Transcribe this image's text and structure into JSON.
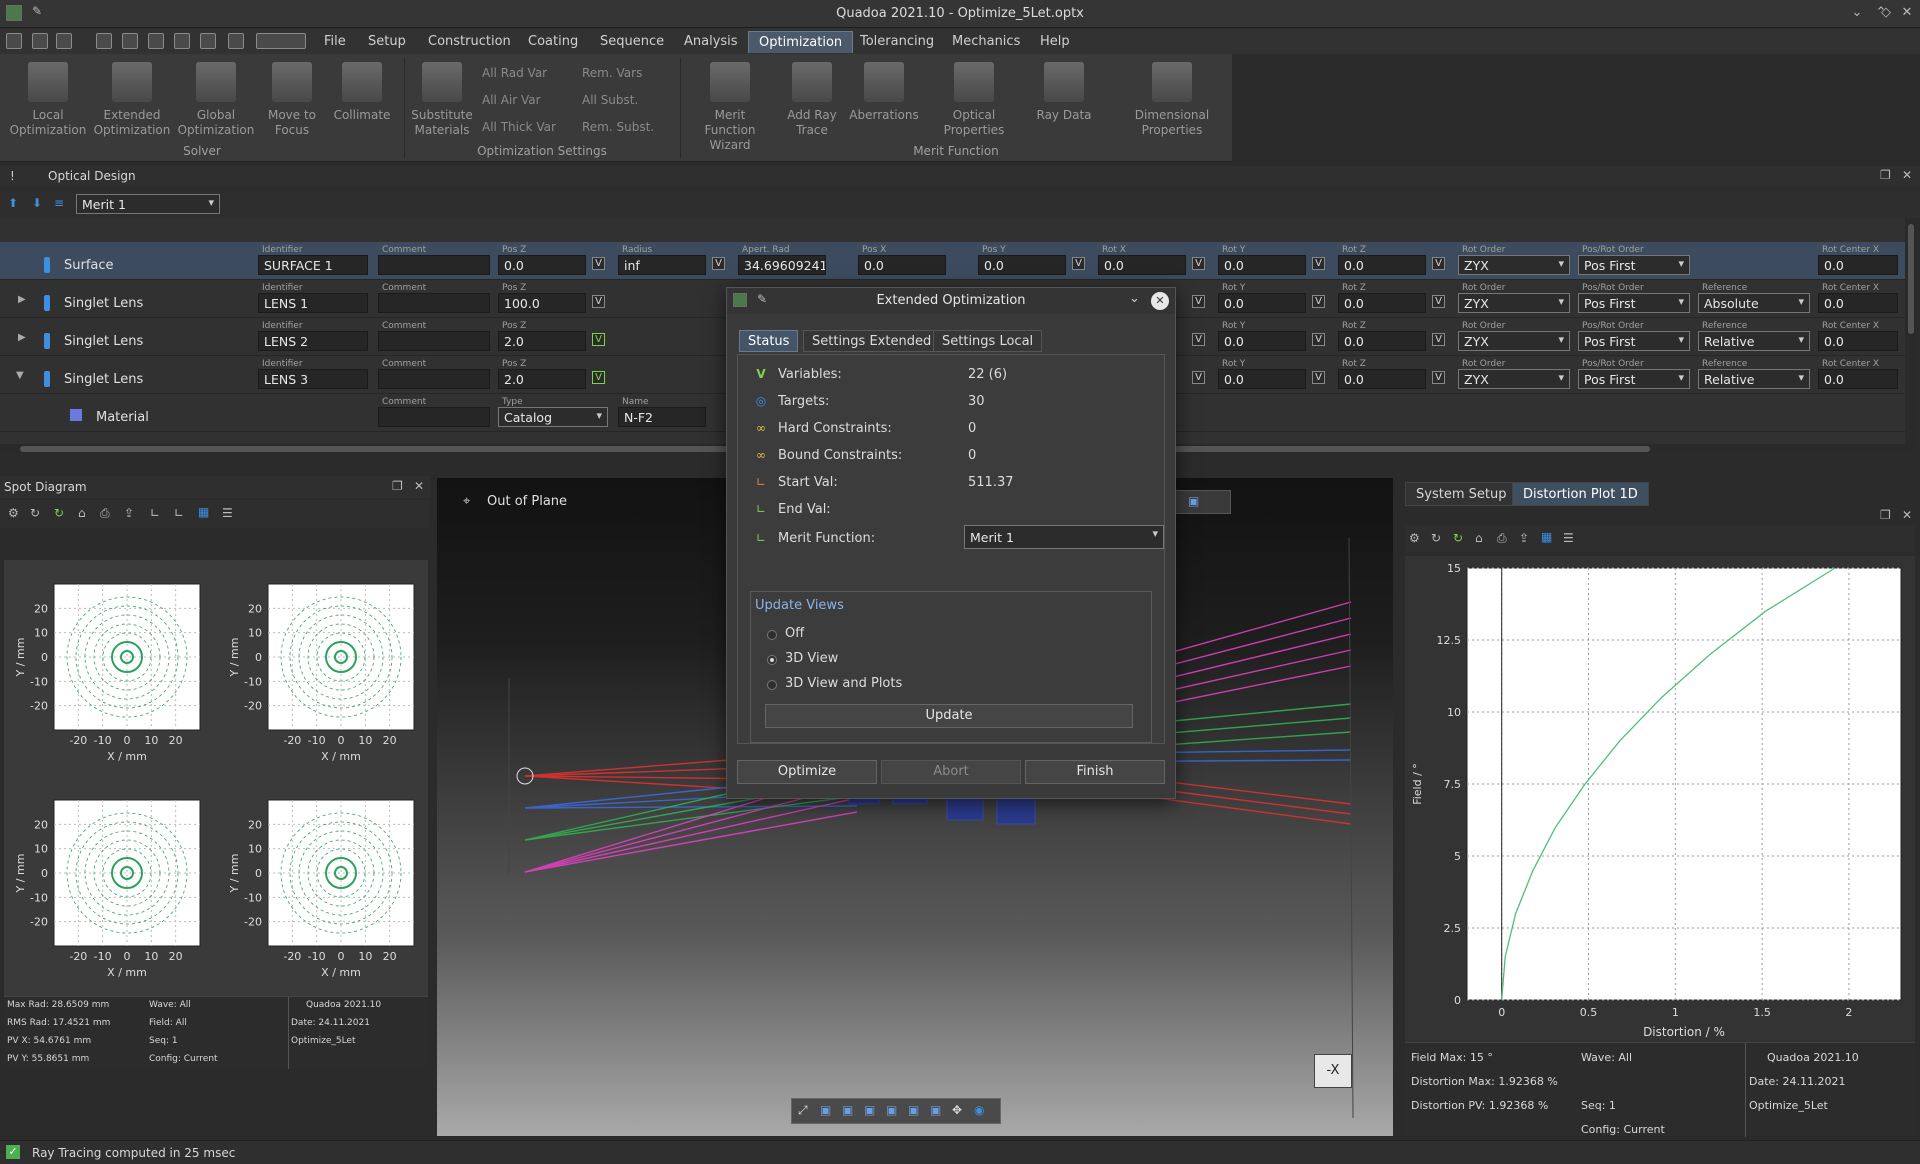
{
  "window": {
    "title": "Quadoa 2021.10 - Optimize_5Let.optx"
  },
  "menu": [
    "File",
    "Setup",
    "Construction",
    "Coating",
    "Sequence",
    "Analysis",
    "Optimization",
    "Tolerancing",
    "Mechanics",
    "Help"
  ],
  "ribbon": {
    "solver": {
      "group": "Solver",
      "buttons": [
        "Local Optimization",
        "Extended Optimization",
        "Global Optimization",
        "Move to Focus",
        "Collimate"
      ]
    },
    "settings": {
      "group": "Optimization Settings",
      "main": "Substitute Materials",
      "small": [
        "All Rad Var",
        "All Air Var",
        "All Thick Var",
        "Rem. Vars",
        "All Subst.",
        "Rem. Subst."
      ]
    },
    "merit": {
      "group": "Merit Function",
      "buttons": [
        "Merit Function Wizard",
        "Add Ray Trace",
        "Aberrations",
        "Optical Properties",
        "Ray Data",
        "Dimensional Properties"
      ]
    }
  },
  "optical_design": {
    "title": "Optical Design",
    "merit_select": "Merit 1",
    "headers": {
      "identifier": "Identifier",
      "comment": "Comment",
      "posz": "Pos Z",
      "radius": "Radius",
      "aperture": "Apert. Rad",
      "posx": "Pos X",
      "posy": "Pos Y",
      "rotx": "Rot X",
      "roty": "Rot Y",
      "rotz": "Rot Z",
      "rotorder": "Rot Order",
      "posrot": "Pos/Rot Order",
      "reference": "Reference",
      "rotcx": "Rot Center X",
      "type": "Type",
      "name": "Name"
    },
    "rows": [
      {
        "label": "Surface",
        "id": "SURFACE 1",
        "posz": "0.0",
        "radius": "inf",
        "aperture": "34.69609241",
        "posx": "0.0",
        "posy": "0.0",
        "rotx": "0.0",
        "roty": "0.0",
        "rotz": "0.0",
        "rotorder": "ZYX",
        "posrot": "Pos First",
        "reference": "",
        "rotcx": "0.0"
      },
      {
        "label": "Singlet Lens",
        "id": "LENS 1",
        "posz": "100.0",
        "roty": "0.0",
        "rotz": "0.0",
        "rotorder": "ZYX",
        "posrot": "Pos First",
        "reference": "Absolute",
        "rotcx": "0.0"
      },
      {
        "label": "Singlet Lens",
        "id": "LENS 2",
        "posz": "2.0",
        "roty": "0.0",
        "rotz": "0.0",
        "rotorder": "ZYX",
        "posrot": "Pos First",
        "reference": "Relative",
        "rotcx": "0.0"
      },
      {
        "label": "Singlet Lens",
        "id": "LENS 3",
        "posz": "2.0",
        "roty": "0.0",
        "rotz": "0.0",
        "rotorder": "ZYX",
        "posrot": "Pos First",
        "reference": "Relative",
        "rotcx": "0.0"
      },
      {
        "label": "Material",
        "type": "Catalog",
        "name": "N-F2"
      }
    ]
  },
  "spot": {
    "title": "Spot Diagram",
    "ylabel": "Y / mm",
    "xlabel": "X / mm",
    "yticks": [
      "20",
      "10",
      "0",
      "-10",
      "-20"
    ],
    "xticks": [
      "-20",
      "-10",
      "0",
      "10",
      "20"
    ],
    "info": {
      "max_rad": "Max Rad: 28.6509 mm",
      "rms_rad": "RMS Rad: 17.4521 mm",
      "pvx": "PV X: 54.6761 mm",
      "pvy": "PV Y: 55.8651 mm",
      "wave": "Wave: All",
      "field": "Field: All",
      "seq": "Seq: 1",
      "config": "Config: Current",
      "app": "Quadoa 2021.10",
      "date": "Date: 24.11.2021",
      "file": "Optimize_5Let"
    }
  },
  "view3d": {
    "label": "Out of Plane",
    "axis": "-X"
  },
  "distortion": {
    "tabs": [
      "System Setup",
      "Distortion Plot 1D"
    ],
    "info": {
      "field_max": "Field Max: 15 °",
      "dist_max": "Distortion Max: 1.92368 %",
      "dist_pv": "Distortion PV: 1.92368 %",
      "wave": "Wave: All",
      "seq": "Seq: 1",
      "config": "Config: Current",
      "app": "Quadoa 2021.10",
      "date": "Date: 24.11.2021",
      "file": "Optimize_5Let"
    }
  },
  "chart_data": {
    "type": "line",
    "title": "",
    "xlabel": "Distortion / %",
    "ylabel": "Field / °",
    "xlim": [
      -0.2,
      2.3
    ],
    "ylim": [
      0,
      15
    ],
    "xticks": [
      "0",
      "0.5",
      "1",
      "1.5",
      "2"
    ],
    "yticks": [
      "0",
      "2.5",
      "5",
      "7.5",
      "10",
      "12.5",
      "15"
    ],
    "grid": true,
    "series": [
      {
        "color": "#4fbf7a",
        "x": [
          0.0,
          0.02,
          0.08,
          0.18,
          0.31,
          0.48,
          0.68,
          0.92,
          1.2,
          1.52,
          1.92
        ],
        "y": [
          0.0,
          1.5,
          3.0,
          4.5,
          6.0,
          7.5,
          9.0,
          10.5,
          12.0,
          13.5,
          15.0
        ]
      }
    ]
  },
  "dialog": {
    "title": "Extended Optimization",
    "tabs": [
      "Status",
      "Settings Extended",
      "Settings Local"
    ],
    "status": {
      "variables_label": "Variables:",
      "variables": "22 (6)",
      "targets_label": "Targets:",
      "targets": "30",
      "hard_label": "Hard Constraints:",
      "hard": "0",
      "bound_label": "Bound Constraints:",
      "bound": "0",
      "start_label": "Start Val:",
      "start": "511.37",
      "end_label": "End Val:",
      "end": "",
      "merit_label": "Merit Function:",
      "merit": "Merit 1"
    },
    "update_views": {
      "title": "Update Views",
      "options": [
        "Off",
        "3D View",
        "3D View and Plots"
      ],
      "selected": "3D View",
      "update_button": "Update"
    },
    "buttons": {
      "optimize": "Optimize",
      "abort": "Abort",
      "finish": "Finish"
    }
  },
  "status": {
    "message": "Ray Tracing computed in 25 msec"
  }
}
